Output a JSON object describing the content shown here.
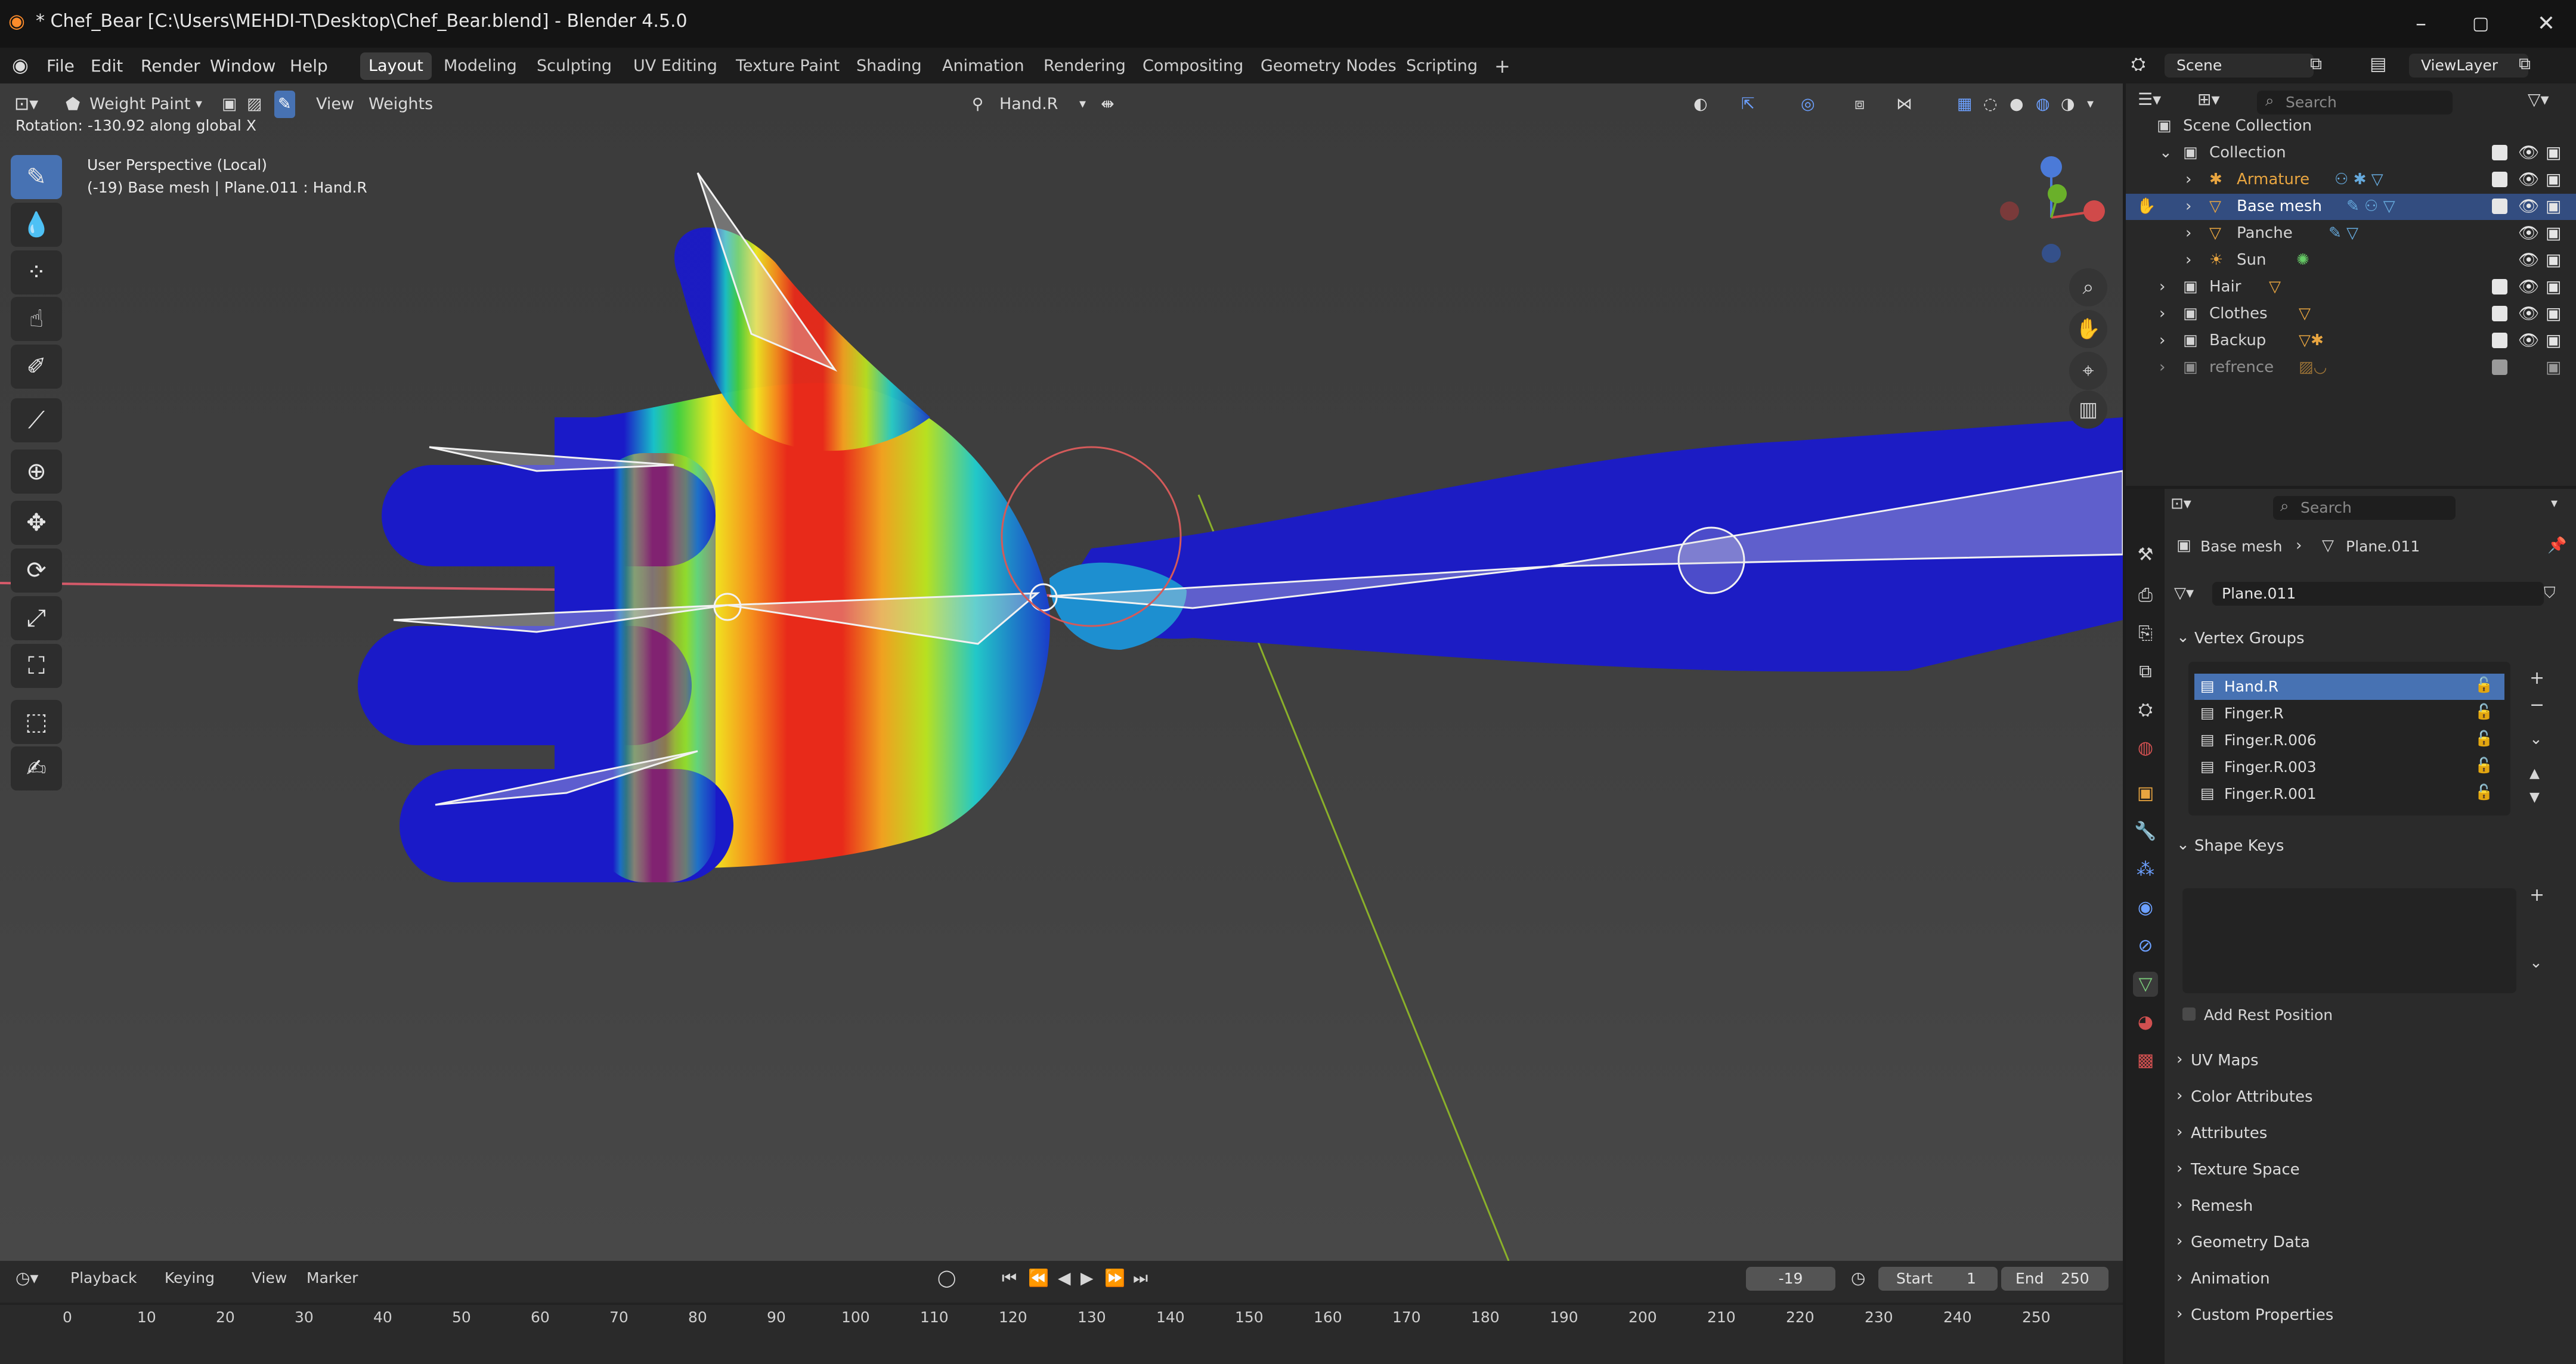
{
  "window": {
    "title": "* Chef_Bear [C:\\Users\\MEHDI-T\\Desktop\\Chef_Bear.blend] - Blender 4.5.0",
    "controls": [
      "–",
      "▢",
      "✕"
    ]
  },
  "menu": [
    "File",
    "Edit",
    "Render",
    "Window",
    "Help"
  ],
  "workspaces": [
    "Layout",
    "Modeling",
    "Sculpting",
    "UV Editing",
    "Texture Paint",
    "Shading",
    "Animation",
    "Rendering",
    "Compositing",
    "Geometry Nodes",
    "Scripting"
  ],
  "active_workspace": "Layout",
  "scene": {
    "label": "Scene",
    "view_layer": "ViewLayer"
  },
  "viewport": {
    "mode": "Weight Paint",
    "menus": [
      "View",
      "Weights"
    ],
    "bone_field": "Hand.R",
    "status": "Rotation: -130.92 along global X",
    "info_line1": "User Perspective (Local)",
    "info_line2": "(-19) Base mesh | Plane.011 : Hand.R",
    "gizmo_axes": [
      "Z",
      "Y",
      "X"
    ],
    "accent": "#4772b3"
  },
  "outliner": {
    "search_placeholder": "Search",
    "root": "Scene Collection",
    "items": [
      {
        "label": "Collection",
        "depth": 1
      },
      {
        "label": "Armature",
        "depth": 2,
        "color": "#e8a540"
      },
      {
        "label": "Base mesh",
        "depth": 2,
        "selected": true
      },
      {
        "label": "Panche",
        "depth": 2
      },
      {
        "label": "Sun",
        "depth": 2
      },
      {
        "label": "Hair",
        "depth": 1
      },
      {
        "label": "Clothes",
        "depth": 1
      },
      {
        "label": "Backup",
        "depth": 1
      },
      {
        "label": "refrence",
        "depth": 1
      }
    ]
  },
  "properties": {
    "search_placeholder": "Search",
    "breadcrumb_object": "Base mesh",
    "breadcrumb_data": "Plane.011",
    "mesh_name": "Plane.011",
    "vertex_groups_title": "Vertex Groups",
    "vertex_groups": [
      "Hand.R",
      "Finger.R",
      "Finger.R.006",
      "Finger.R.003",
      "Finger.R.001"
    ],
    "shape_keys_title": "Shape Keys",
    "add_rest_position": "Add Rest Position",
    "collapsed_panels": [
      "UV Maps",
      "Color Attributes",
      "Attributes",
      "Texture Space",
      "Remesh",
      "Geometry Data",
      "Animation",
      "Custom Properties"
    ]
  },
  "timeline": {
    "menus": [
      "Playback",
      "Keying",
      "View",
      "Marker"
    ],
    "current_frame": "-19",
    "start_label": "Start",
    "start_value": "1",
    "end_label": "End",
    "end_value": "250",
    "ticks": [
      "0",
      "10",
      "20",
      "30",
      "40",
      "50",
      "60",
      "70",
      "80",
      "90",
      "100",
      "110",
      "120",
      "130",
      "140",
      "150",
      "160",
      "170",
      "180",
      "190",
      "200",
      "210",
      "220",
      "230",
      "240",
      "250"
    ]
  }
}
